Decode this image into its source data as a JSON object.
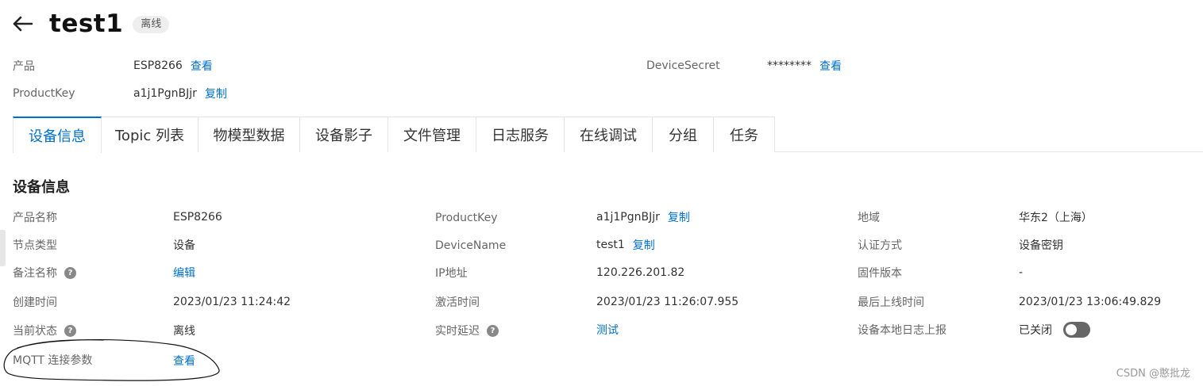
{
  "header": {
    "title": "test1",
    "status_badge": "离线"
  },
  "meta": {
    "product_label": "产品",
    "product_value": "ESP8266",
    "product_link": "查看",
    "secret_label": "DeviceSecret",
    "secret_value": "********",
    "secret_link": "查看",
    "productkey_label": "ProductKey",
    "productkey_value": "a1j1PgnBJjr",
    "productkey_link": "复制"
  },
  "tabs": [
    {
      "label": "设备信息"
    },
    {
      "label": "Topic 列表"
    },
    {
      "label": "物模型数据"
    },
    {
      "label": "设备影子"
    },
    {
      "label": "文件管理"
    },
    {
      "label": "日志服务"
    },
    {
      "label": "在线调试"
    },
    {
      "label": "分组"
    },
    {
      "label": "任务"
    }
  ],
  "info": {
    "section_title": "设备信息",
    "product_name_label": "产品名称",
    "product_name_value": "ESP8266",
    "node_type_label": "节点类型",
    "node_type_value": "设备",
    "remark_label": "备注名称",
    "remark_link": "编辑",
    "created_label": "创建时间",
    "created_value": "2023/01/23 11:24:42",
    "status_label": "当前状态",
    "status_value": "离线",
    "mqtt_label": "MQTT 连接参数",
    "mqtt_link": "查看",
    "productkey_label": "ProductKey",
    "productkey_value": "a1j1PgnBJjr",
    "productkey_link": "复制",
    "devicename_label": "DeviceName",
    "devicename_value": "test1",
    "devicename_link": "复制",
    "ip_label": "IP地址",
    "ip_value": "120.226.201.82",
    "activated_label": "激活时间",
    "activated_value": "2023/01/23 11:26:07.955",
    "latency_label": "实时延迟",
    "latency_link": "测试",
    "region_label": "地域",
    "region_value": "华东2（上海）",
    "auth_label": "认证方式",
    "auth_value": "设备密钥",
    "firmware_label": "固件版本",
    "firmware_value": "-",
    "last_online_label": "最后上线时间",
    "last_online_value": "2023/01/23 13:06:49.829",
    "local_log_label": "设备本地日志上报",
    "local_log_value": "已关闭",
    "local_log_enabled": false
  },
  "watermark": "CSDN @憨批龙",
  "colors": {
    "link": "#0070cc",
    "active_tab": "#0070cc",
    "toggle_off": "#666666"
  }
}
